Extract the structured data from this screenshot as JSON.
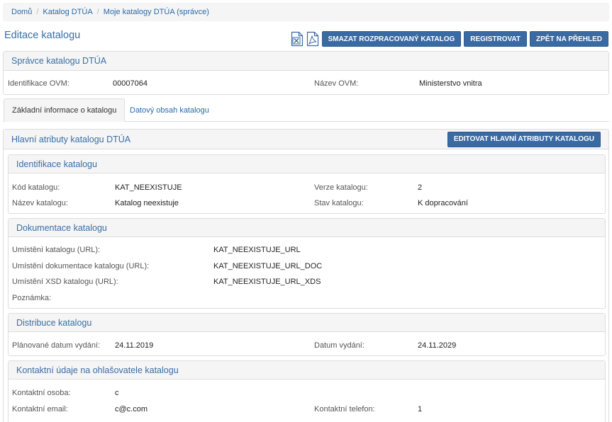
{
  "breadcrumb": {
    "items": [
      "Domů",
      "Katalog DTÚA",
      "Moje katalogy DTÚA (správce)"
    ],
    "separator": "/"
  },
  "page": {
    "title": "Editace katalogu"
  },
  "toolbar": {
    "export_xls_icon": "excel-file-icon",
    "export_pdf_icon": "pdf-file-icon",
    "delete_label": "SMAZAT ROZPRACOVANÝ KATALOG",
    "register_label": "REGISTROVAT",
    "back_label": "ZPĚT NA PŘEHLED"
  },
  "spravce": {
    "title": "Správce katalogu DTÚA",
    "ovm_id_label": "Identifikace OVM:",
    "ovm_id_value": "00007064",
    "ovm_name_label": "Název OVM:",
    "ovm_name_value": "Ministerstvo vnitra"
  },
  "tabs": [
    {
      "label": "Základní informace o katalogu",
      "active": true
    },
    {
      "label": "Datový obsah katalogu",
      "active": false
    }
  ],
  "main": {
    "title": "Hlavní atributy katalogu DTÚA",
    "edit_label": "EDITOVAT HLAVNÍ ATRIBUTY KATALOGU"
  },
  "identifikace": {
    "title": "Identifikace katalogu",
    "code_label": "Kód katalogu:",
    "code_value": "KAT_NEEXISTUJE",
    "version_label": "Verze katalogu:",
    "version_value": "2",
    "name_label": "Název katalogu:",
    "name_value": "Katalog neexistuje",
    "state_label": "Stav katalogu:",
    "state_value": "K dopracování"
  },
  "dokumentace": {
    "title": "Dokumentace katalogu",
    "url_label": "Umístění katalogu (URL):",
    "url_value": "KAT_NEEXISTUJE_URL",
    "doc_label": "Umístění dokumentace katalogu (URL):",
    "doc_value": "KAT_NEEXISTUJE_URL_DOC",
    "xsd_label": "Umístění XSD katalogu (URL):",
    "xsd_value": "KAT_NEEXISTUJE_URL_XDS",
    "note_label": "Poznámka:",
    "note_value": ""
  },
  "distribuce": {
    "title": "Distribuce katalogu",
    "planned_label": "Plánované datum vydání:",
    "planned_value": "24.11.2019",
    "release_label": "Datum vydání:",
    "release_value": "24.11.2029"
  },
  "kontakt": {
    "title": "Kontaktní údaje na ohlašovatele katalogu",
    "person_label": "Kontaktní osoba:",
    "person_value": "c",
    "email_label": "Kontaktní email:",
    "email_value": "c@c.com",
    "phone_label": "Kontaktní telefon:",
    "phone_value": "1"
  },
  "colors": {
    "primary": "#3a6aa3",
    "link": "#2a6aa8",
    "heading": "#3a6ea5",
    "panel_bg": "#f5f5f5",
    "border": "#dddddd"
  }
}
